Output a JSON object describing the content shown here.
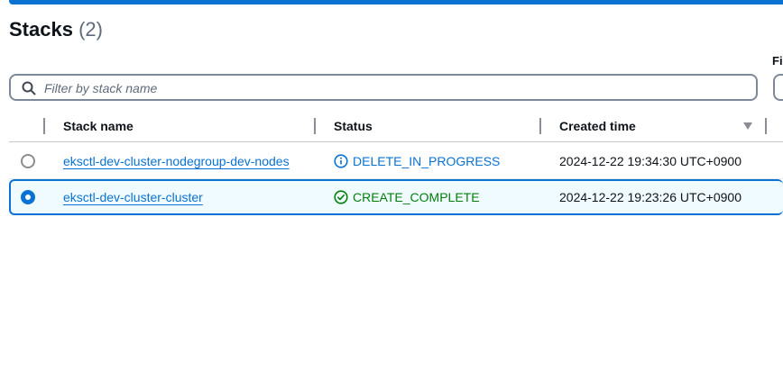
{
  "header": {
    "title": "Stacks",
    "count": "(2)"
  },
  "filter": {
    "side_label": "Fi",
    "placeholder": "Filter by stack name"
  },
  "table": {
    "columns": [
      "Stack name",
      "Status",
      "Created time"
    ],
    "rows": [
      {
        "selected": false,
        "name": "eksctl-dev-cluster-nodegroup-dev-nodes",
        "status": "DELETE_IN_PROGRESS",
        "status_type": "info",
        "created": "2024-12-22 19:34:30 UTC+0900"
      },
      {
        "selected": true,
        "name": "eksctl-dev-cluster-cluster",
        "status": "CREATE_COMPLETE",
        "status_type": "success",
        "created": "2024-12-22 19:23:26 UTC+0900"
      }
    ]
  },
  "colors": {
    "accent": "#0972d3",
    "success": "#037f0c",
    "text": "#0f141a",
    "muted": "#5f6b7a"
  }
}
